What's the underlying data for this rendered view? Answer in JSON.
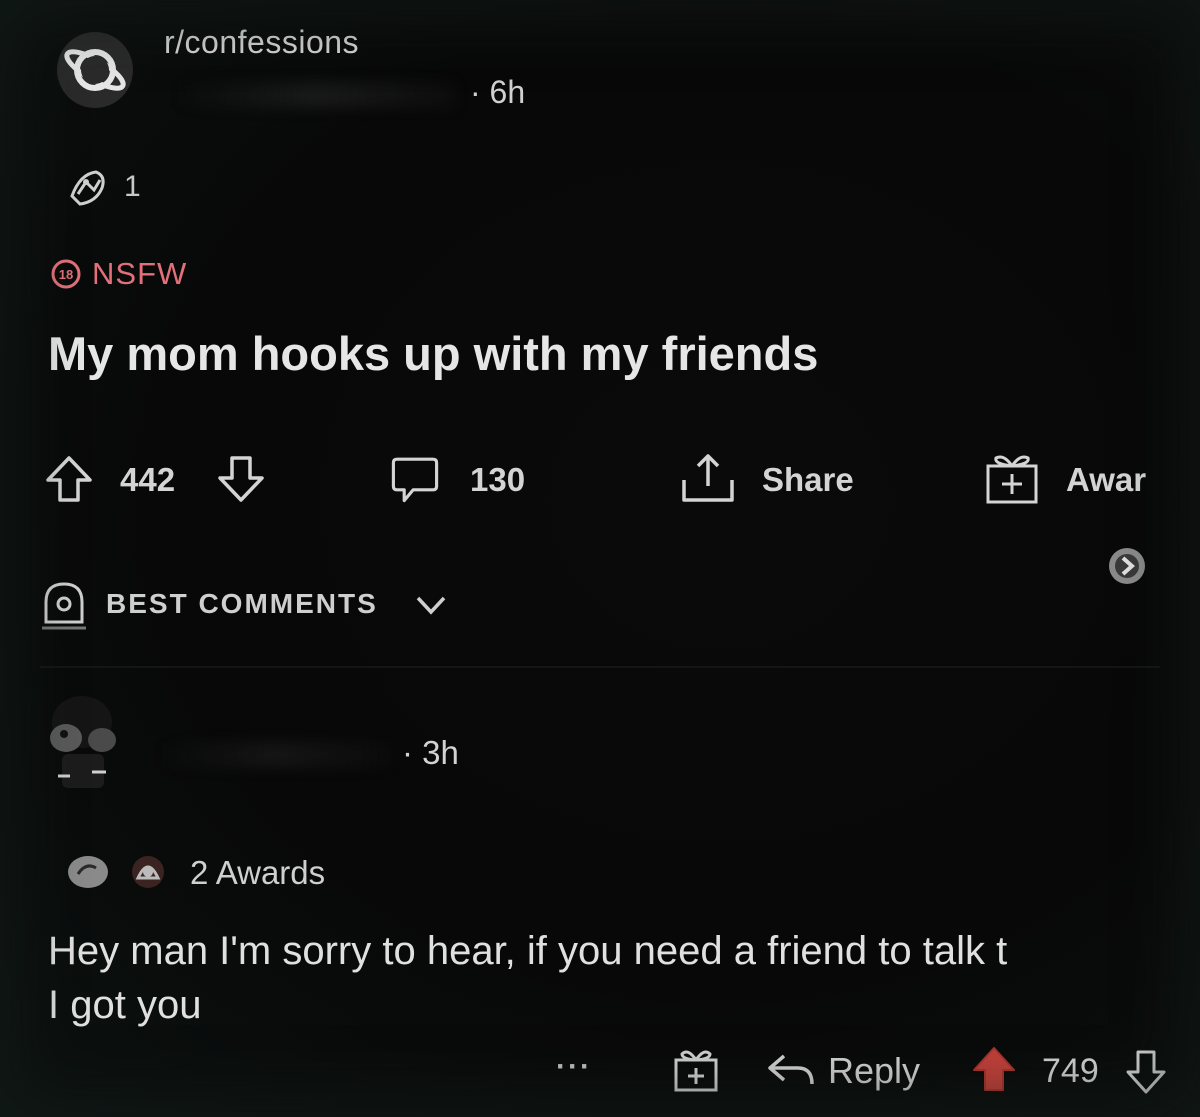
{
  "post": {
    "subreddit": "r/confessions",
    "time": "· 6h",
    "award_count": "1",
    "nsfw_label": "NSFW",
    "title": "My mom hooks up with my friends",
    "upvotes": "442",
    "comments": "130",
    "share_label": "Share",
    "award_label": "Awar"
  },
  "sort": {
    "label": "BEST COMMENTS"
  },
  "comment": {
    "time": "· 3h",
    "awards_label": "2 Awards",
    "body": "Hey man I'm sorry to hear, if you need a friend to talk t\nI got you",
    "more_label": "···",
    "reply_label": "Reply",
    "score": "749"
  },
  "colors": {
    "nsfw": "#e2707a",
    "upvoted": "#c0403a",
    "background": "#050505"
  },
  "icons": {
    "subreddit": "planet-icon",
    "award": "award-icon",
    "nsfw": "nsfw-icon",
    "upvote": "upvote-icon",
    "downvote": "downvote-icon",
    "comment": "comment-icon",
    "share": "share-icon",
    "gift": "gift-icon",
    "sort": "rocket-icon",
    "reply": "reply-icon"
  }
}
